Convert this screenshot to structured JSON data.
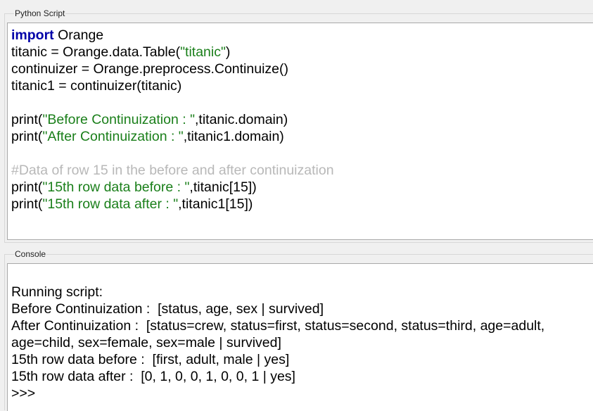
{
  "script_panel": {
    "title": "Python Script",
    "lines": [
      [
        {
          "t": "kw",
          "v": "import"
        },
        {
          "t": "plain",
          "v": " Orange"
        }
      ],
      [
        {
          "t": "plain",
          "v": "titanic = Orange.data.Table("
        },
        {
          "t": "str",
          "v": "\"titanic\""
        },
        {
          "t": "plain",
          "v": ")"
        }
      ],
      [
        {
          "t": "plain",
          "v": "continuizer = Orange.preprocess.Continuize()"
        }
      ],
      [
        {
          "t": "plain",
          "v": "titanic1 = continuizer(titanic)"
        }
      ],
      [],
      [
        {
          "t": "plain",
          "v": "print("
        },
        {
          "t": "str",
          "v": "\"Before Continuization : \""
        },
        {
          "t": "plain",
          "v": ",titanic.domain)"
        }
      ],
      [
        {
          "t": "plain",
          "v": "print("
        },
        {
          "t": "str",
          "v": "\"After Continuization : \""
        },
        {
          "t": "plain",
          "v": ",titanic1.domain)"
        }
      ],
      [],
      [
        {
          "t": "cmt",
          "v": "#Data of row 15 in the before and after continuization"
        }
      ],
      [
        {
          "t": "plain",
          "v": "print("
        },
        {
          "t": "str",
          "v": "\"15th row data before : \""
        },
        {
          "t": "plain",
          "v": ",titanic[15])"
        }
      ],
      [
        {
          "t": "plain",
          "v": "print("
        },
        {
          "t": "str",
          "v": "\"15th row data after : \""
        },
        {
          "t": "plain",
          "v": ",titanic1[15])"
        }
      ]
    ]
  },
  "console_panel": {
    "title": "Console",
    "lines": [
      "Running script:",
      "Before Continuization :  [status, age, sex | survived]",
      "After Continuization :  [status=crew, status=first, status=second, status=third, age=adult,",
      "age=child, sex=female, sex=male | survived]",
      "15th row data before :  [first, adult, male | yes]",
      "15th row data after :  [0, 1, 0, 0, 1, 0, 0, 1 | yes]",
      ">>>"
    ]
  }
}
